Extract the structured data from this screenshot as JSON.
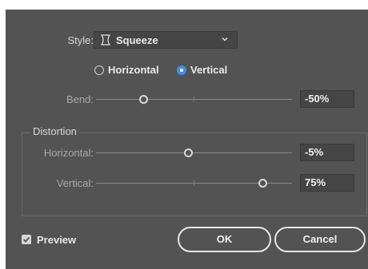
{
  "style": {
    "label": "Style:",
    "value": "Squeeze",
    "icon": "squeeze-warp-icon"
  },
  "orientation": {
    "options": [
      {
        "label": "Horizontal",
        "selected": false
      },
      {
        "label": "Vertical",
        "selected": true
      }
    ]
  },
  "bend": {
    "label": "Bend:",
    "value": "-50%",
    "level_percent": -50
  },
  "distortion": {
    "title": "Distortion",
    "horizontal": {
      "label": "Horizontal:",
      "value": "-5%",
      "level_percent": -5
    },
    "vertical": {
      "label": "Vertical:",
      "value": "75%",
      "level_percent": 75
    }
  },
  "preview": {
    "label": "Preview",
    "checked": true
  },
  "buttons": {
    "ok": "OK",
    "cancel": "Cancel"
  },
  "colors": {
    "background": "#535353",
    "field": "#454545",
    "accent": "#3f8df0",
    "text": "#d6d6d6"
  }
}
